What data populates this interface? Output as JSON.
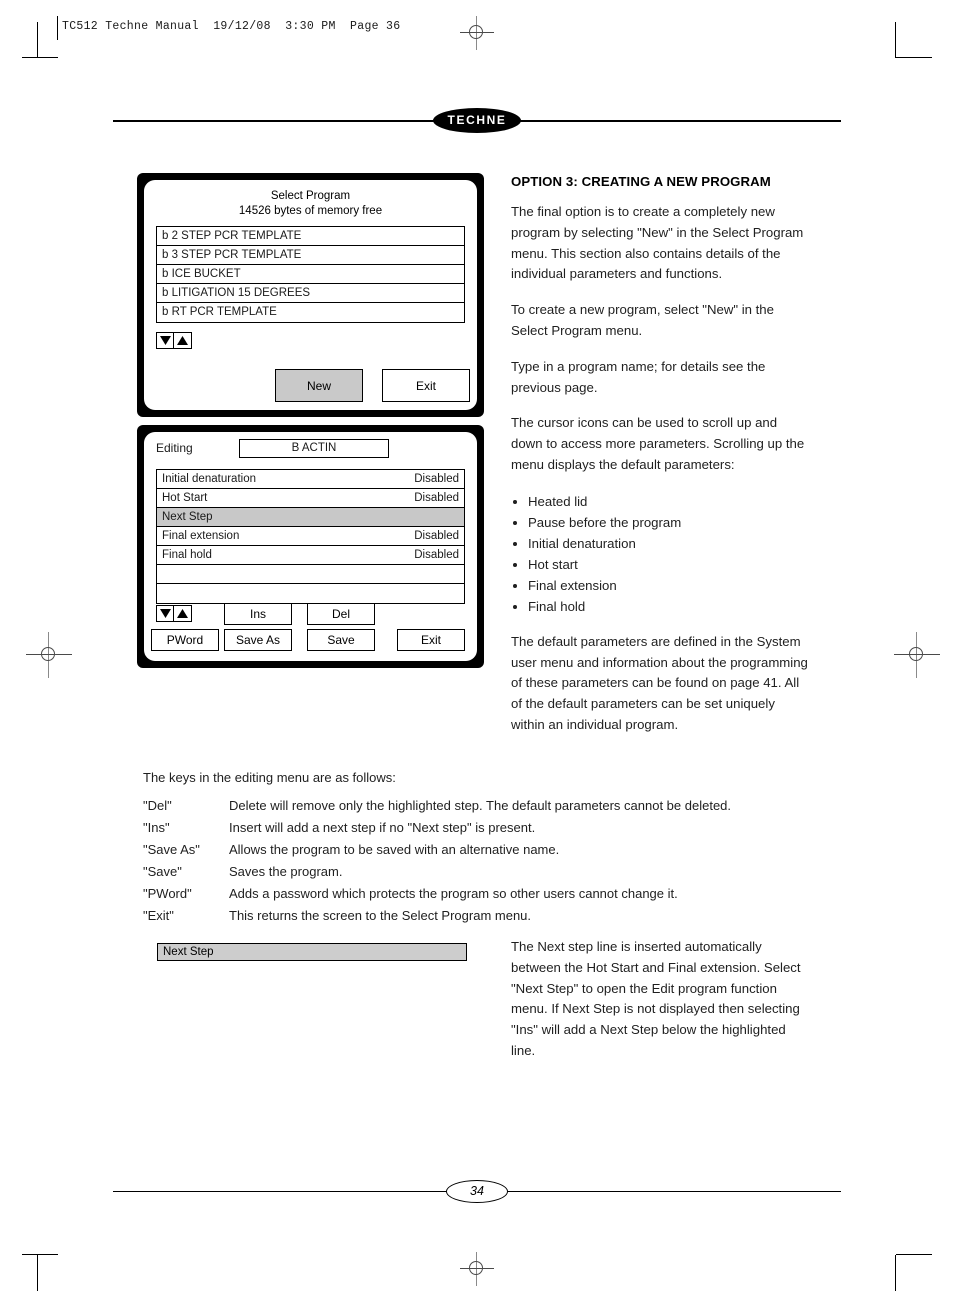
{
  "print_header": "TC512 Techne Manual  19/12/08  3:30 PM  Page 36",
  "brand": "TECHNE",
  "page_number": "34",
  "select_program_screen": {
    "title": "Select Program",
    "memory_line": "14526 bytes of memory free",
    "programs": [
      "b 2 STEP PCR TEMPLATE",
      "b 3 STEP PCR TEMPLATE",
      "b ICE BUCKET",
      "b LITIGATION 15 DEGREES",
      "b RT PCR TEMPLATE"
    ],
    "scroll_down_icon": "down-triangle-icon",
    "scroll_up_icon": "up-triangle-icon",
    "new_button": "New",
    "exit_button": "Exit",
    "highlight_color": "#c9c9c9"
  },
  "editing_screen": {
    "mode_label": "Editing",
    "program_name": "B ACTIN",
    "rows": [
      {
        "label": "Initial denaturation",
        "value": "Disabled",
        "selected": false
      },
      {
        "label": "Hot Start",
        "value": "Disabled",
        "selected": false
      },
      {
        "label": "Next Step",
        "value": "",
        "selected": true
      },
      {
        "label": "Final extension",
        "value": "Disabled",
        "selected": false
      },
      {
        "label": "Final hold",
        "value": "Disabled",
        "selected": false
      },
      {
        "label": "",
        "value": "",
        "selected": false
      },
      {
        "label": "",
        "value": "",
        "selected": false
      }
    ],
    "scroll_down_icon": "down-triangle-icon",
    "scroll_up_icon": "up-triangle-icon",
    "buttons_row1": [
      "Ins",
      "Del"
    ],
    "buttons_row2": [
      "PWord",
      "Save As",
      "Save",
      "Exit"
    ],
    "selection_color": "#c8c8c8"
  },
  "article": {
    "heading": "OPTION 3: CREATING A NEW PROGRAM",
    "para1": "The final option is to create a completely new program by selecting \"New\" in the Select Program menu. This section also contains details of the individual parameters and functions.",
    "para2": "To create a new program, select \"New\" in the Select Program menu.",
    "para3": "Type in a program name; for details see the previous page.",
    "para4": "The cursor icons can be used to scroll up and down to access more parameters. Scrolling up the menu displays the default parameters:",
    "default_parameters": [
      "Heated lid",
      "Pause before the program",
      "Initial denaturation",
      "Hot start",
      "Final extension",
      "Final hold"
    ],
    "para5": "The default parameters are defined in the System user menu and information about the programming of these parameters can be found on page 41. All of the default parameters can be set uniquely within an individual program."
  },
  "keys_section": {
    "intro": "The keys in the editing menu are as follows:",
    "rows": [
      {
        "key": "\"Del\"",
        "description": "Delete will remove only the highlighted step. The default parameters cannot be deleted."
      },
      {
        "key": "\"Ins\"",
        "description": "Insert will add a next step if no \"Next step\" is present."
      },
      {
        "key": "\"Save As\"",
        "description": "Allows the program to be saved with an alternative name."
      },
      {
        "key": "\"Save\"",
        "description": "Saves the program."
      },
      {
        "key": "\"PWord\"",
        "description": "Adds a password which protects the program so other users cannot change it."
      },
      {
        "key": "\"Exit\"",
        "description": "This returns the screen to the Select Program menu."
      }
    ]
  },
  "next_step_section": {
    "bar_label": "Next Step",
    "description": "The Next step line is inserted automatically between the Hot Start and Final extension. Select \"Next Step\" to open the Edit program function menu. If Next Step is not displayed then selecting \"Ins\" will add a Next Step below the highlighted line."
  }
}
